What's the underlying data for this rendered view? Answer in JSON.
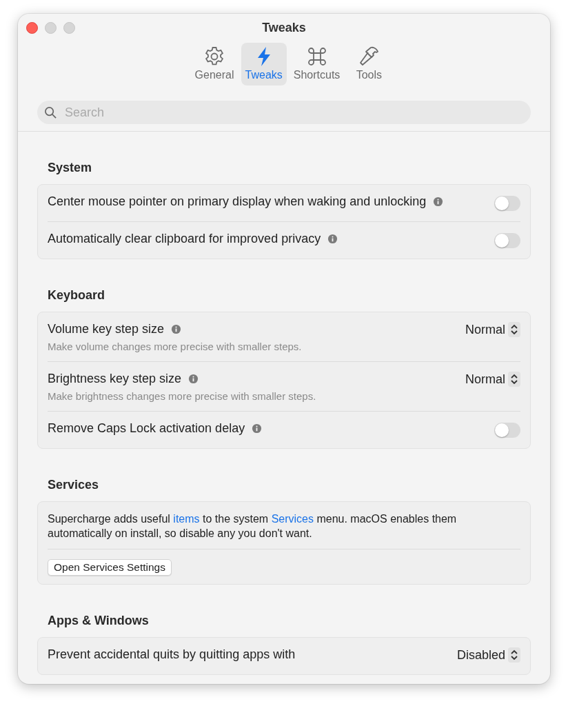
{
  "window": {
    "title": "Tweaks"
  },
  "tabs": [
    {
      "label": "General",
      "selected": false
    },
    {
      "label": "Tweaks",
      "selected": true
    },
    {
      "label": "Shortcuts",
      "selected": false
    },
    {
      "label": "Tools",
      "selected": false
    }
  ],
  "search": {
    "placeholder": "Search"
  },
  "sections": [
    {
      "title": "System",
      "kind": "rows",
      "rows": [
        {
          "kind": "toggle",
          "label": "Center mouse pointer on primary display when waking and unlocking",
          "info": true,
          "on": false
        },
        {
          "kind": "toggle",
          "label": "Automatically clear clipboard for improved privacy",
          "info": true,
          "on": false
        }
      ]
    },
    {
      "title": "Keyboard",
      "kind": "rows",
      "rows": [
        {
          "kind": "select",
          "label": "Volume key step size",
          "info": true,
          "value": "Normal",
          "description": "Make volume changes more precise with smaller steps."
        },
        {
          "kind": "select",
          "label": "Brightness key step size",
          "info": true,
          "value": "Normal",
          "description": "Make brightness changes more precise with smaller steps."
        },
        {
          "kind": "toggle",
          "label": "Remove Caps Lock activation delay",
          "info": true,
          "on": false
        }
      ]
    },
    {
      "title": "Services",
      "kind": "note",
      "parts": [
        {
          "kind": "text",
          "text": "Supercharge adds useful "
        },
        {
          "kind": "link",
          "text": "items"
        },
        {
          "kind": "text",
          "text": " to the system "
        },
        {
          "kind": "link",
          "text": "Services"
        },
        {
          "kind": "text",
          "text": " menu. macOS enables them automatically on install, so disable any you don't want."
        }
      ],
      "button": "Open Services Settings"
    },
    {
      "title": "Apps & Windows",
      "kind": "rows",
      "rows": [
        {
          "kind": "select",
          "label": "Prevent accidental quits by quitting apps with",
          "info": false,
          "value": "Disabled"
        }
      ]
    }
  ]
}
